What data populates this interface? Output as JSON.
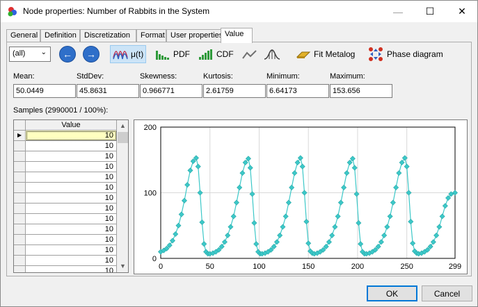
{
  "window": {
    "title": "Node properties: Number of Rabbits in the System",
    "minimize": "—",
    "maximize": "☐",
    "close": "✕"
  },
  "tabs": [
    {
      "label": "General"
    },
    {
      "label": "Definition"
    },
    {
      "label": "Discretization"
    },
    {
      "label": "Format"
    },
    {
      "label": "User properties"
    },
    {
      "label": "Value"
    }
  ],
  "toolbar": {
    "select_value": "(all)",
    "back_icon": "arrow-left-icon",
    "forward_icon": "arrow-right-icon",
    "mu_label": "μ(t)",
    "pdf_label": "PDF",
    "cdf_label": "CDF",
    "fit_label": "Fit Metalog",
    "phase_label": "Phase diagram"
  },
  "stats": [
    {
      "label": "Mean:",
      "value": "50.0449"
    },
    {
      "label": "StdDev:",
      "value": "45.8631"
    },
    {
      "label": "Skewness:",
      "value": "0.966771"
    },
    {
      "label": "Kurtosis:",
      "value": "2.61759"
    },
    {
      "label": "Minimum:",
      "value": "6.64173"
    },
    {
      "label": "Maximum:",
      "value": "153.656"
    }
  ],
  "samples_label": "Samples (2990001 / 100%):",
  "grid": {
    "header": "Value",
    "rows": [
      "10",
      "10",
      "10",
      "10",
      "10",
      "10",
      "10",
      "10",
      "10",
      "10",
      "10",
      "10",
      "10",
      "10"
    ]
  },
  "chart_data": {
    "type": "scatter",
    "title": "",
    "xlabel": "",
    "ylabel": "",
    "xlim": [
      0,
      299
    ],
    "ylim": [
      0,
      200
    ],
    "x_ticks": [
      0,
      50,
      100,
      150,
      200,
      250,
      299
    ],
    "y_ticks": [
      0,
      100,
      200
    ],
    "grid": true,
    "marker_color": "#3cc8c8",
    "series": [
      {
        "x": [
          0,
          3,
          6,
          9,
          12,
          15,
          18,
          21,
          24,
          27,
          30,
          33,
          36,
          38,
          40,
          42,
          44,
          46,
          48,
          50,
          53,
          56,
          59,
          62,
          65,
          68,
          71,
          74,
          77,
          80,
          83,
          86,
          89,
          91,
          93,
          95,
          97,
          99,
          101,
          103,
          106,
          109,
          112,
          115,
          118,
          121,
          124,
          127,
          130,
          133,
          136,
          139,
          142,
          144,
          146,
          148,
          150,
          152,
          154,
          156,
          159,
          162,
          165,
          168,
          171,
          174,
          177,
          180,
          183,
          186,
          189,
          192,
          195,
          197,
          199,
          201,
          203,
          205,
          207,
          209,
          212,
          215,
          218,
          221,
          224,
          227,
          230,
          233,
          236,
          239,
          242,
          245,
          248,
          250,
          252,
          254,
          256,
          258,
          260,
          262,
          265,
          268,
          271,
          274,
          277,
          280,
          283,
          286,
          289,
          292,
          295,
          299
        ],
        "y": [
          10,
          12,
          15,
          20,
          27,
          37,
          50,
          67,
          88,
          112,
          134,
          148,
          153,
          140,
          100,
          55,
          22,
          10,
          7,
          7,
          8,
          10,
          13,
          18,
          25,
          35,
          48,
          64,
          85,
          108,
          130,
          146,
          152,
          138,
          98,
          54,
          22,
          10,
          7,
          7,
          8,
          10,
          13,
          18,
          25,
          35,
          48,
          64,
          85,
          108,
          130,
          146,
          153,
          140,
          100,
          56,
          23,
          11,
          8,
          7,
          8,
          10,
          13,
          18,
          25,
          35,
          48,
          64,
          85,
          108,
          130,
          146,
          152,
          138,
          98,
          54,
          22,
          10,
          7,
          7,
          8,
          10,
          13,
          18,
          25,
          35,
          48,
          64,
          85,
          108,
          130,
          146,
          153,
          140,
          100,
          56,
          23,
          11,
          8,
          7,
          8,
          10,
          13,
          18,
          25,
          35,
          48,
          64,
          80,
          92,
          98,
          100
        ]
      }
    ]
  },
  "buttons": {
    "ok": "OK",
    "cancel": "Cancel"
  }
}
